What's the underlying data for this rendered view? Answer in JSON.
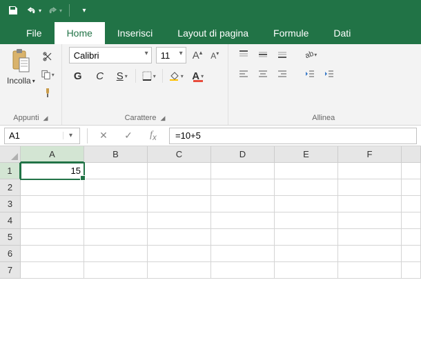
{
  "qat": {
    "save": "save",
    "undo": "undo",
    "redo": "redo"
  },
  "tabs": {
    "file": "File",
    "home": "Home",
    "insert": "Inserisci",
    "pagelayout": "Layout di pagina",
    "formulas": "Formule",
    "data": "Dati"
  },
  "clipboard": {
    "paste": "Incolla",
    "group_label": "Appunti"
  },
  "font": {
    "name": "Calibri",
    "size": "11",
    "bold": "G",
    "italic": "C",
    "underline": "S",
    "group_label": "Carattere"
  },
  "alignment": {
    "group_label": "Allinea"
  },
  "namebox": "A1",
  "formula": "=10+5",
  "columns": [
    "A",
    "B",
    "C",
    "D",
    "E",
    "F"
  ],
  "rows": [
    "1",
    "2",
    "3",
    "4",
    "5",
    "6",
    "7"
  ],
  "active_cell": {
    "row": 0,
    "col": 0,
    "display": "15"
  },
  "chart_data": {
    "type": "table",
    "columns": [
      "A",
      "B",
      "C",
      "D",
      "E",
      "F"
    ],
    "data": [
      [
        15,
        null,
        null,
        null,
        null,
        null
      ],
      [
        null,
        null,
        null,
        null,
        null,
        null
      ],
      [
        null,
        null,
        null,
        null,
        null,
        null
      ],
      [
        null,
        null,
        null,
        null,
        null,
        null
      ],
      [
        null,
        null,
        null,
        null,
        null,
        null
      ],
      [
        null,
        null,
        null,
        null,
        null,
        null
      ],
      [
        null,
        null,
        null,
        null,
        null,
        null
      ]
    ],
    "formulas": {
      "A1": "=10+5"
    }
  }
}
